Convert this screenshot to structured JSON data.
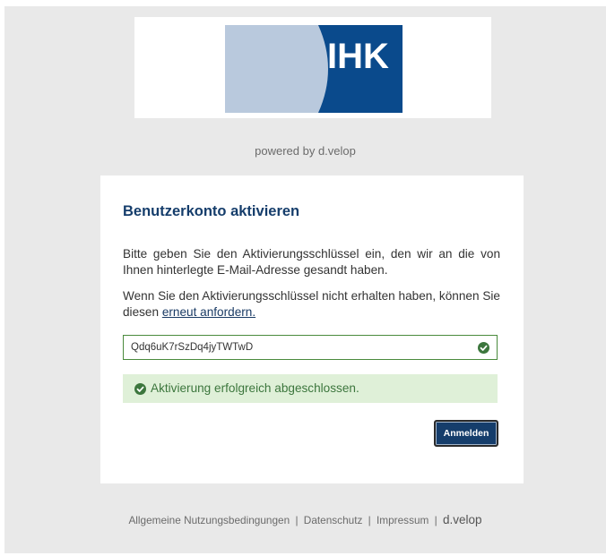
{
  "header": {
    "logo_text": "IHK",
    "powered_by": "powered by d.velop"
  },
  "card": {
    "title": "Benutzerkonto aktivieren",
    "instruction": "Bitte geben Sie den Aktivierungsschlüssel ein, den wir an die von Ihnen hinterlegte E-Mail-Adresse gesandt haben.",
    "resend_prefix": "Wenn Sie den Aktivierungsschlüssel nicht erhalten haben, können Sie diesen",
    "resend_link": "erneut anfordern.",
    "activation_key_value": "Qdq6uK7rSzDq4jyTWTwD",
    "success_message": "Aktivierung erfolgreich abgeschlossen.",
    "login_button": "Anmelden"
  },
  "footer": {
    "terms": "Allgemeine Nutzungsbedingungen",
    "privacy": "Datenschutz",
    "imprint": "Impressum",
    "separator": "|",
    "brand": "d.velop"
  },
  "colors": {
    "ihk_blue": "#0a4a8c",
    "ihk_light_blue": "#b9c9dd",
    "title_blue": "#153d6b",
    "success_green": "#3c763d",
    "success_background": "#dff0d8",
    "page_background": "#e9e9e9"
  }
}
